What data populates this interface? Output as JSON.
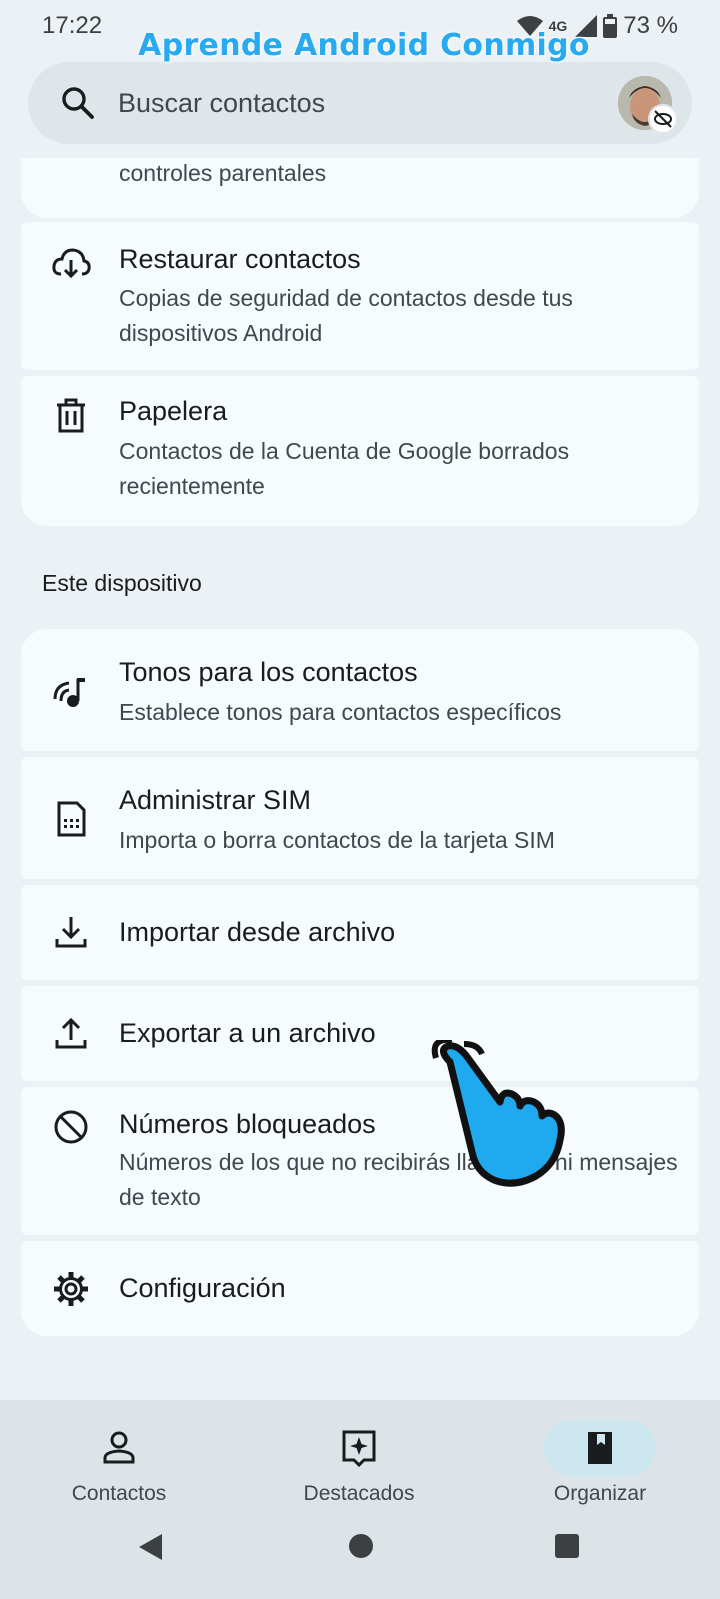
{
  "status": {
    "time": "17:22",
    "network": "4G",
    "battery": "73 %"
  },
  "watermark": "Aprende Android Conmigo",
  "search": {
    "placeholder": "Buscar contactos"
  },
  "cards_top": [
    {
      "title": "",
      "sub": "controles parentales",
      "icon": "partial"
    },
    {
      "title": "Restaurar contactos",
      "sub": "Copias de seguridad de contactos desde tus dispositivos Android",
      "icon": "cloud-download-icon"
    },
    {
      "title": "Papelera",
      "sub": "Contactos de la Cuenta de Google borrados recientemente",
      "icon": "trash-icon"
    }
  ],
  "section": {
    "device_label": "Este dispositivo"
  },
  "cards_device": [
    {
      "title": "Tonos para los contactos",
      "sub": "Establece tonos para contactos específicos",
      "icon": "ringtone-icon"
    },
    {
      "title": "Administrar SIM",
      "sub": "Importa o borra contactos de la tarjeta SIM",
      "icon": "sim-card-icon"
    },
    {
      "title": "Importar desde archivo",
      "sub": "",
      "icon": "download-icon"
    },
    {
      "title": "Exportar a un archivo",
      "sub": "",
      "icon": "upload-icon"
    },
    {
      "title": "Números bloqueados",
      "sub": "Números de los que no recibirás llamadas ni mensajes de texto",
      "icon": "block-icon"
    },
    {
      "title": "Configuración",
      "sub": "",
      "icon": "gear-icon"
    }
  ],
  "nav": [
    {
      "label": "Contactos",
      "icon": "person-icon",
      "selected": false
    },
    {
      "label": "Destacados",
      "icon": "highlights-icon",
      "selected": false
    },
    {
      "label": "Organizar",
      "icon": "book-icon",
      "selected": true
    }
  ],
  "colors": {
    "card_bg": "#f6fbfe",
    "page_bg": "#ebf1f4",
    "nav_bg": "#dde4e8",
    "selected_pill": "#cde7f1",
    "watermark": "#29a9f0",
    "hand": "#1fa9ef"
  }
}
